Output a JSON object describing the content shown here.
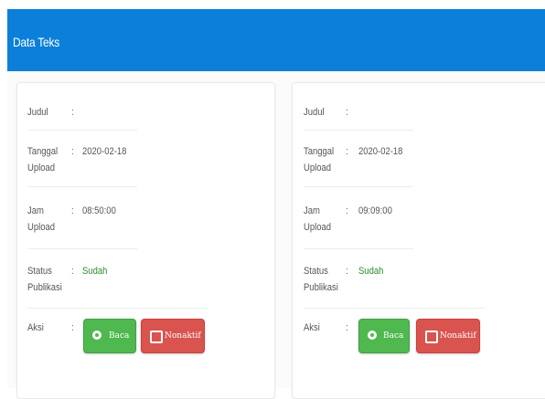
{
  "header": {
    "title": "Data Teks"
  },
  "labels": {
    "judul": "Judul",
    "tanggal_1": "Tanggal",
    "tanggal_2": "Upload",
    "jam_1": "Jam",
    "jam_2": "Upload",
    "status_1": "Status",
    "status_2": "Publikasi",
    "aksi": "Aksi",
    "colon": ":"
  },
  "items": [
    {
      "judul": "",
      "tanggal_upload": "2020-02-18",
      "jam_upload": "08:50:00",
      "status_publikasi": "Sudah",
      "baca_label": "Baca",
      "nonaktif_label": "Nonaktif"
    },
    {
      "judul": "",
      "tanggal_upload": "2020-02-18",
      "jam_upload": "09:09:00",
      "status_publikasi": "Sudah",
      "baca_label": "Baca",
      "nonaktif_label": "Nonaktif"
    }
  ],
  "colors": {
    "header_bg": "#0b7fd9",
    "status_ok": "#2e8b2e",
    "baca_bg": "#4fb84f",
    "nonaktif_bg": "#d9534f"
  },
  "icons": {
    "baca": "eye-icon",
    "nonaktif": "power-icon"
  }
}
